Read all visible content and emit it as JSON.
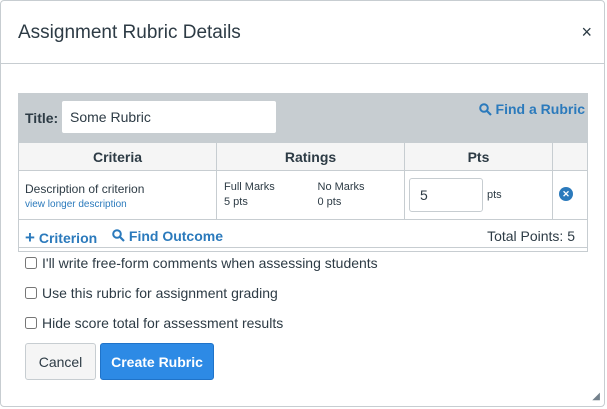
{
  "dialog": {
    "title": "Assignment Rubric Details",
    "close_glyph": "×"
  },
  "rubric": {
    "title_label": "Title:",
    "title_value": "Some Rubric",
    "find_rubric_label": "Find a Rubric",
    "headers": {
      "criteria": "Criteria",
      "ratings": "Ratings",
      "pts": "Pts"
    },
    "criterion": {
      "description": "Description of criterion",
      "longer_link": "view longer description",
      "ratings": [
        {
          "label": "Full Marks",
          "points": "5 pts"
        },
        {
          "label": "No Marks",
          "points": "0 pts"
        }
      ],
      "points_value": "5",
      "points_unit": "pts"
    },
    "add_criterion_label": "Criterion",
    "find_outcome_label": "Find Outcome",
    "total_points": "Total Points: 5"
  },
  "options": {
    "free_form": "I'll write free-form comments when assessing students",
    "use_for_grading": "Use this rubric for assignment grading",
    "hide_score": "Hide score total for assessment results"
  },
  "buttons": {
    "cancel": "Cancel",
    "create": "Create Rubric"
  },
  "colors": {
    "accent": "#2b7abc",
    "primary_button": "#2d8ae5",
    "header_bg": "#c7cdd1"
  }
}
